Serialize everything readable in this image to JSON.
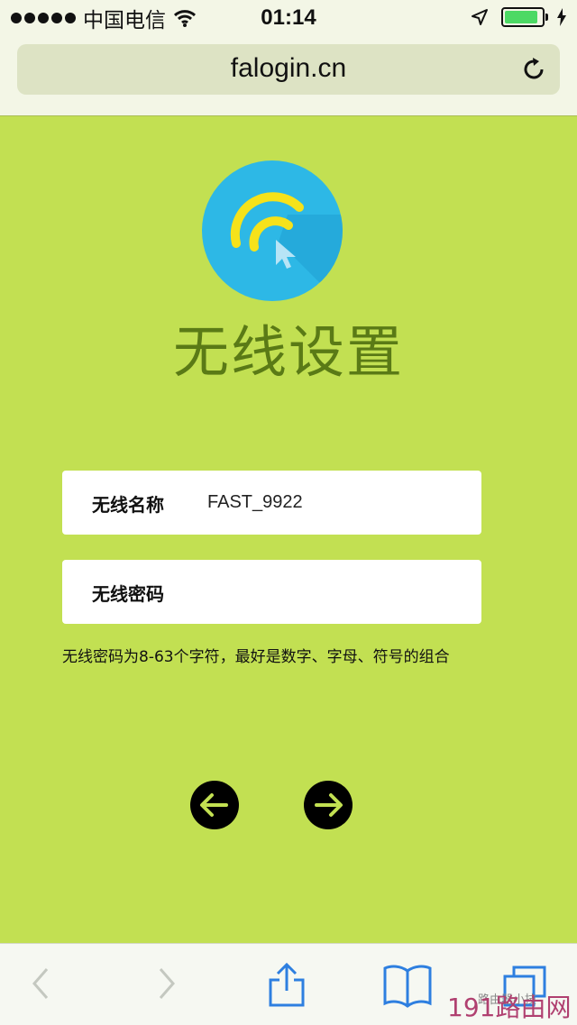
{
  "status_bar": {
    "carrier": "中国电信",
    "time": "01:14"
  },
  "browser": {
    "url": "falogin.cn"
  },
  "page": {
    "title": "无线设置"
  },
  "form": {
    "ssid_label": "无线名称",
    "ssid_value": "FAST_9922",
    "password_label": "无线密码",
    "password_value": "",
    "hint": "无线密码为8-63个字符，最好是数字、字母、符号的组合"
  },
  "watermark": {
    "text": "191路由网",
    "overlay": "路由器小技"
  },
  "colors": {
    "background": "#c2e052",
    "title": "#5a7a16",
    "logo_circle": "#2db8e6",
    "logo_arc": "#f6e21a"
  }
}
